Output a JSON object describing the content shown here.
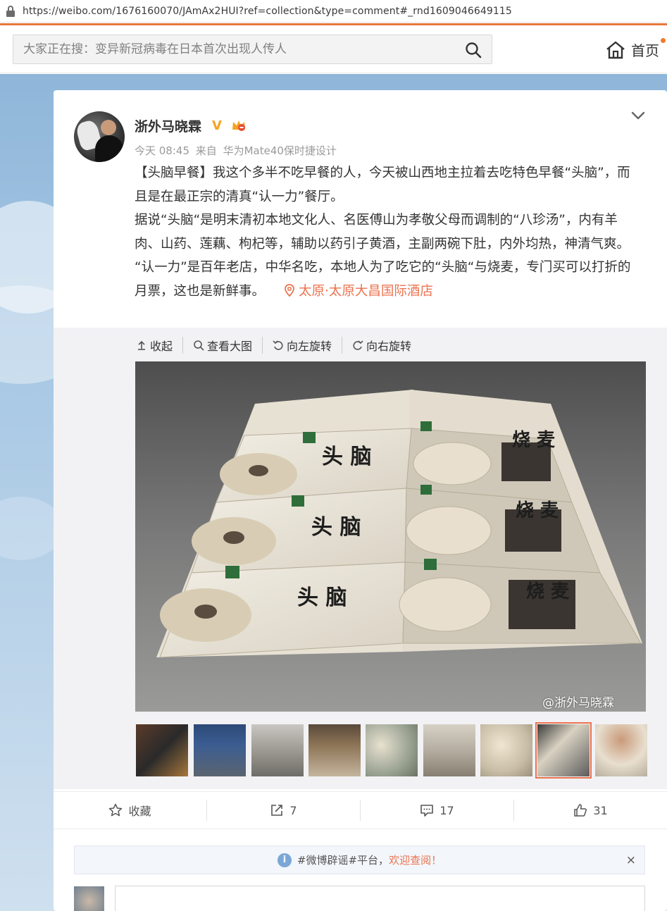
{
  "browser": {
    "url": "https://weibo.com/1676160070/JAmAx2HUI?ref=collection&type=comment#_rnd1609046649115"
  },
  "header": {
    "search_placeholder": "大家正在搜：变异新冠病毒在日本首次出现人传人",
    "home_label": "首页"
  },
  "post": {
    "username": "浙外马晓霖",
    "verified_badge": "V",
    "time": "今天 08:45",
    "source_prefix": "来自",
    "source": "华为Mate40保时捷设计",
    "paragraphs": [
      "【头脑早餐】我这个多半不吃早餐的人，今天被山西地主拉着去吃特色早餐“头脑”，而且是在最正宗的清真“认一力”餐厅。",
      "据说“头脑“是明末清初本地文化人、名医傅山为孝敬父母而调制的“八珍汤”，内有羊肉、山药、莲藕、枸杞等，辅助以药引子黄酒，主副两碗下肚，内外均热，神清气爽。",
      "“认一力”是百年老店，中华名吃，本地人为了吃它的“头脑“与烧麦，专门买可以打折的月票，这也是新鲜事。"
    ],
    "location": "太原·太原大昌国际酒店"
  },
  "media_tools": {
    "collapse": "收起",
    "view_large": "查看大图",
    "rotate_left": "向左旋转",
    "rotate_right": "向右旋转"
  },
  "watermark": "@浙外马晓霖",
  "thumbnails": {
    "count": 9,
    "selected_index": 7
  },
  "actions": {
    "favorite": "收藏",
    "repost": "7",
    "comment": "17",
    "like": "31"
  },
  "notice": {
    "text": "#微博辟谣#平台，",
    "link": "欢迎查阅！",
    "close": "×"
  },
  "colors": {
    "accent": "#eb7350",
    "orange_line": "#e8763d",
    "verified": "#f6a320"
  }
}
